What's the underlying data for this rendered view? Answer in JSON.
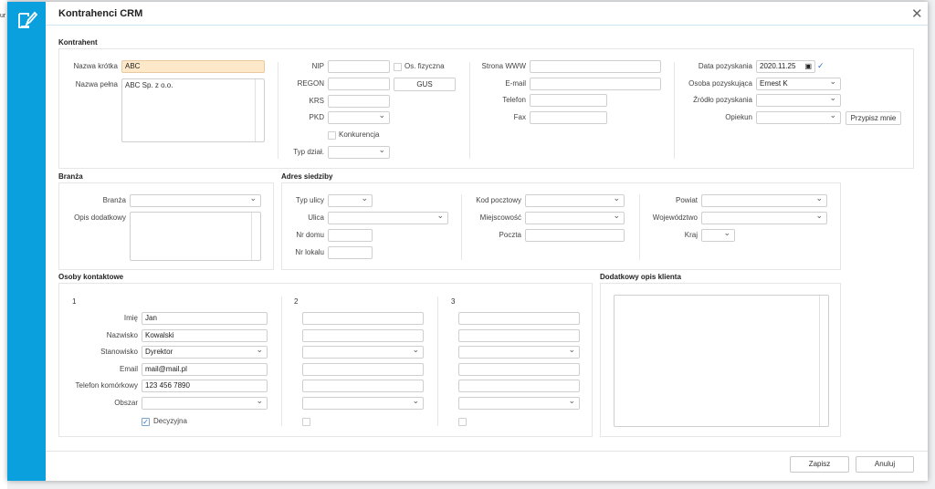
{
  "window": {
    "title": "Kontrahenci CRM",
    "background_fragment": "ur"
  },
  "kontrahent": {
    "title": "Kontrahent",
    "nazwa_krotka": {
      "label": "Nazwa krótka",
      "value": "ABC"
    },
    "nazwa_pelna": {
      "label": "Nazwa pełna",
      "value": "ABC Sp. z o.o."
    },
    "nip": "NIP",
    "os_fizyczna": "Os. fizyczna",
    "regon": "REGON",
    "gus": "GUS",
    "krs": "KRS",
    "pkd": "PKD",
    "konkurencja": "Konkurencja",
    "typ_dzial": "Typ dział.",
    "strona_www": "Strona WWW",
    "email": "E-mail",
    "telefon": "Telefon",
    "fax": "Fax",
    "data_pozyskania": {
      "label": "Data pozyskania",
      "value": "2020.11.25"
    },
    "osoba_pozyskujaca": {
      "label": "Osoba pozyskująca",
      "value": "Ernest K"
    },
    "zrodlo": "Źródło pozyskania",
    "opiekun": "Opiekun",
    "przypisz": "Przypisz mnie"
  },
  "branza": {
    "title": "Branża",
    "branza": "Branża",
    "opis": "Opis dodatkowy"
  },
  "adres": {
    "title": "Adres siedziby",
    "typ_ulicy": "Typ ulicy",
    "ulica": "Ulica",
    "nr_domu": "Nr domu",
    "nr_lokalu": "Nr lokalu",
    "kod": "Kod pocztowy",
    "miejscowosc": "Miejscowość",
    "poczta": "Poczta",
    "powiat": "Powiat",
    "wojewodztwo": "Województwo",
    "kraj": "Kraj"
  },
  "osoby": {
    "title": "Osoby kontaktowe",
    "cols": [
      "1",
      "2",
      "3"
    ],
    "labels": {
      "imie": "Imię",
      "nazwisko": "Nazwisko",
      "stanowisko": "Stanowisko",
      "email": "Email",
      "telefon": "Telefon komórkowy",
      "obszar": "Obszar",
      "decyzyjna": "Decyzyjna"
    },
    "person1": {
      "imie": "Jan",
      "nazwisko": "Kowalski",
      "stanowisko": "Dyrektor",
      "email": "mail@mail.pl",
      "telefon": "123 456 7890",
      "decyzyjna": true
    }
  },
  "opis_klienta": {
    "title": "Dodatkowy opis klienta"
  },
  "footer": {
    "save": "Zapisz",
    "cancel": "Anuluj"
  },
  "colors": {
    "accent": "#0aa0de",
    "highlight_input": "#fde9c9"
  }
}
